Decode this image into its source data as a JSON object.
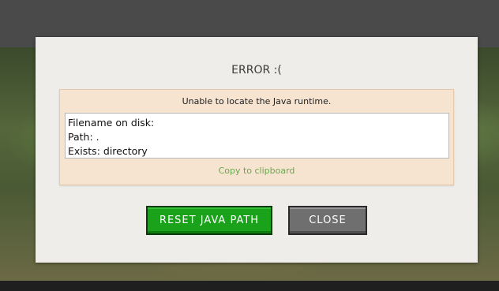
{
  "dialog": {
    "title": "ERROR :(",
    "message": "Unable to locate the Java runtime.",
    "details": [
      "Filename on disk:",
      "Path: .",
      "Exists: directory"
    ],
    "copy_label": "Copy to clipboard",
    "buttons": {
      "reset_label": "RESET JAVA PATH",
      "close_label": "CLOSE"
    }
  },
  "colors": {
    "dialog_bg": "#efede9",
    "panel_bg": "#f6e3d0",
    "link": "#6aa84f",
    "primary_button": "#1aa21a",
    "secondary_button": "#6f6f6f"
  }
}
